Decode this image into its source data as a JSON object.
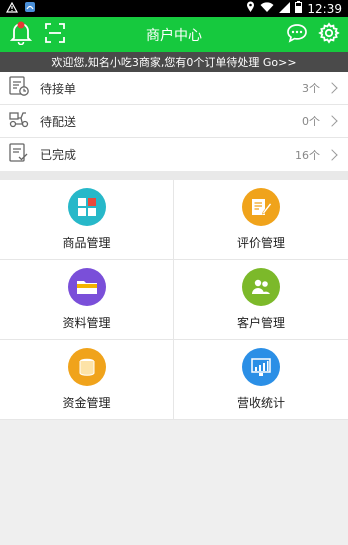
{
  "statusbar": {
    "time": "12:39"
  },
  "appbar": {
    "title": "商户中心"
  },
  "notice": {
    "text": "欢迎您,知名小吃3商家,您有0个订单待处理 Go>>"
  },
  "orders": [
    {
      "label": "待接单",
      "count": "3个"
    },
    {
      "label": "待配送",
      "count": "0个"
    },
    {
      "label": "已完成",
      "count": "16个"
    }
  ],
  "grid": [
    {
      "label": "商品管理",
      "icon": "goods-icon",
      "color": "#27b8c9"
    },
    {
      "label": "评价管理",
      "icon": "review-icon",
      "color": "#f0a31b"
    },
    {
      "label": "资料管理",
      "icon": "folder-icon",
      "color": "#7a4fd9"
    },
    {
      "label": "客户管理",
      "icon": "customers-icon",
      "color": "#7cb92a"
    },
    {
      "label": "资金管理",
      "icon": "coins-icon",
      "color": "#f0a31b"
    },
    {
      "label": "营收统计",
      "icon": "chart-icon",
      "color": "#2b8fe6"
    }
  ]
}
